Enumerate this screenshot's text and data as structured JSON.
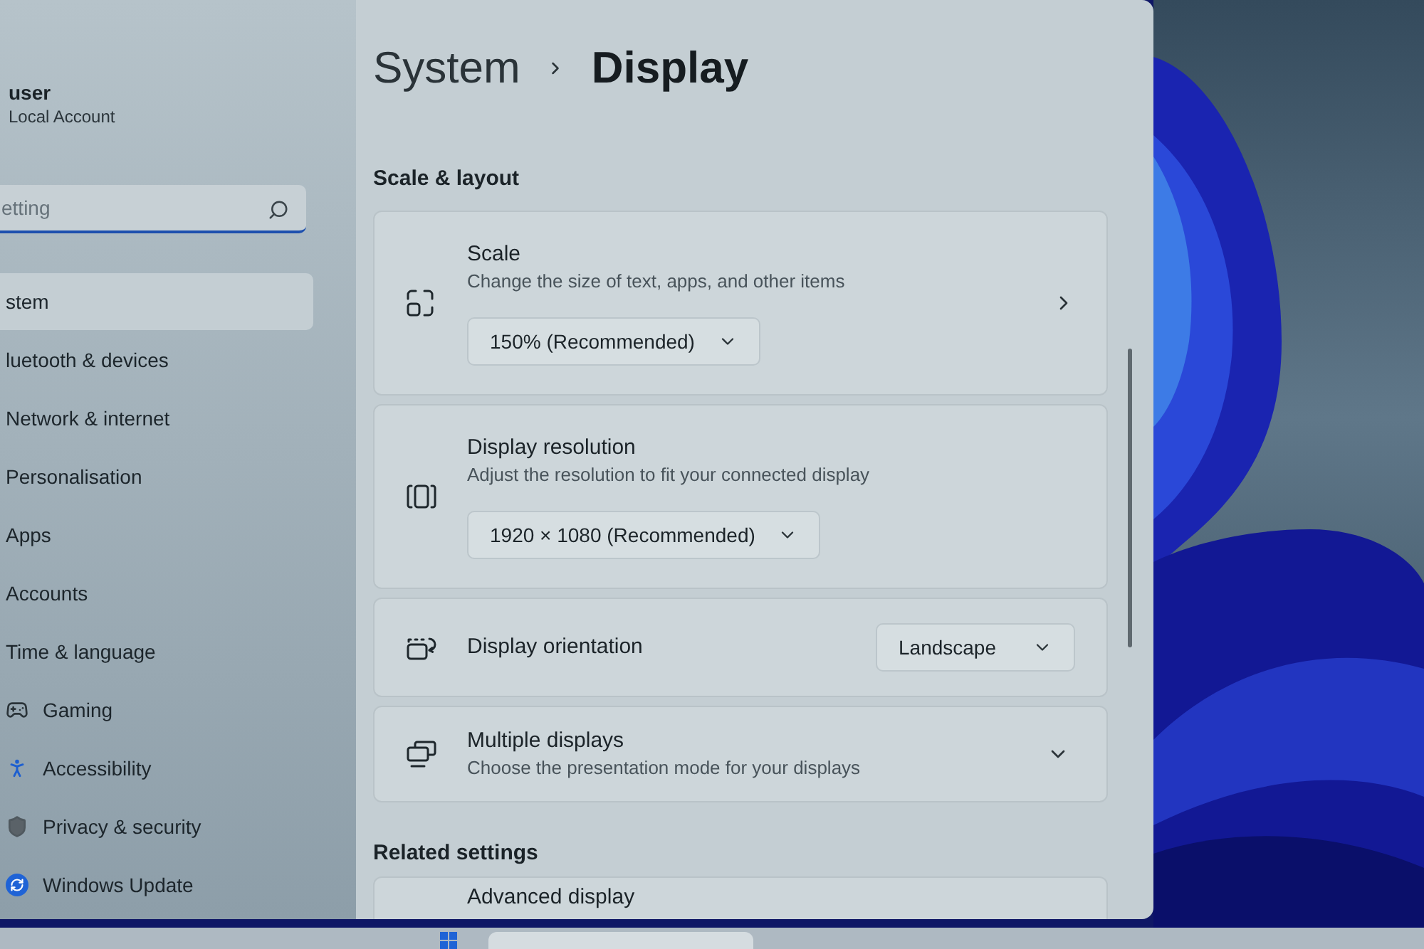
{
  "user": {
    "name": "user",
    "account_type": "Local Account"
  },
  "search": {
    "placeholder": "etting"
  },
  "sidebar": {
    "items": [
      {
        "label": "stem",
        "selected": true
      },
      {
        "label": "luetooth & devices",
        "selected": false
      },
      {
        "label": "Network & internet",
        "selected": false
      },
      {
        "label": "Personalisation",
        "selected": false
      },
      {
        "label": "Apps",
        "selected": false
      },
      {
        "label": "Accounts",
        "selected": false
      },
      {
        "label": "Time & language",
        "selected": false
      },
      {
        "label": "Gaming",
        "selected": false
      },
      {
        "label": "Accessibility",
        "selected": false
      },
      {
        "label": "Privacy & security",
        "selected": false
      },
      {
        "label": "Windows Update",
        "selected": false
      }
    ]
  },
  "breadcrumb": {
    "parent": "System",
    "current": "Display"
  },
  "sections": [
    {
      "heading": "Scale & layout",
      "settings": [
        {
          "kind": "stacked",
          "title": "Scale",
          "description": "Change the size of text, apps, and other items",
          "value": "150% (Recommended)",
          "navigable": true
        },
        {
          "kind": "stacked",
          "title": "Display resolution",
          "description": "Adjust the resolution to fit your connected display",
          "value": "1920 × 1080 (Recommended)",
          "navigable": false
        },
        {
          "kind": "inline",
          "title": "Display orientation",
          "value": "Landscape"
        },
        {
          "kind": "expander",
          "title": "Multiple displays",
          "description": "Choose the presentation mode for your displays",
          "expanded": false
        }
      ]
    },
    {
      "heading": "Related settings",
      "settings": [
        {
          "kind": "link",
          "title": "Advanced display"
        }
      ]
    }
  ]
}
